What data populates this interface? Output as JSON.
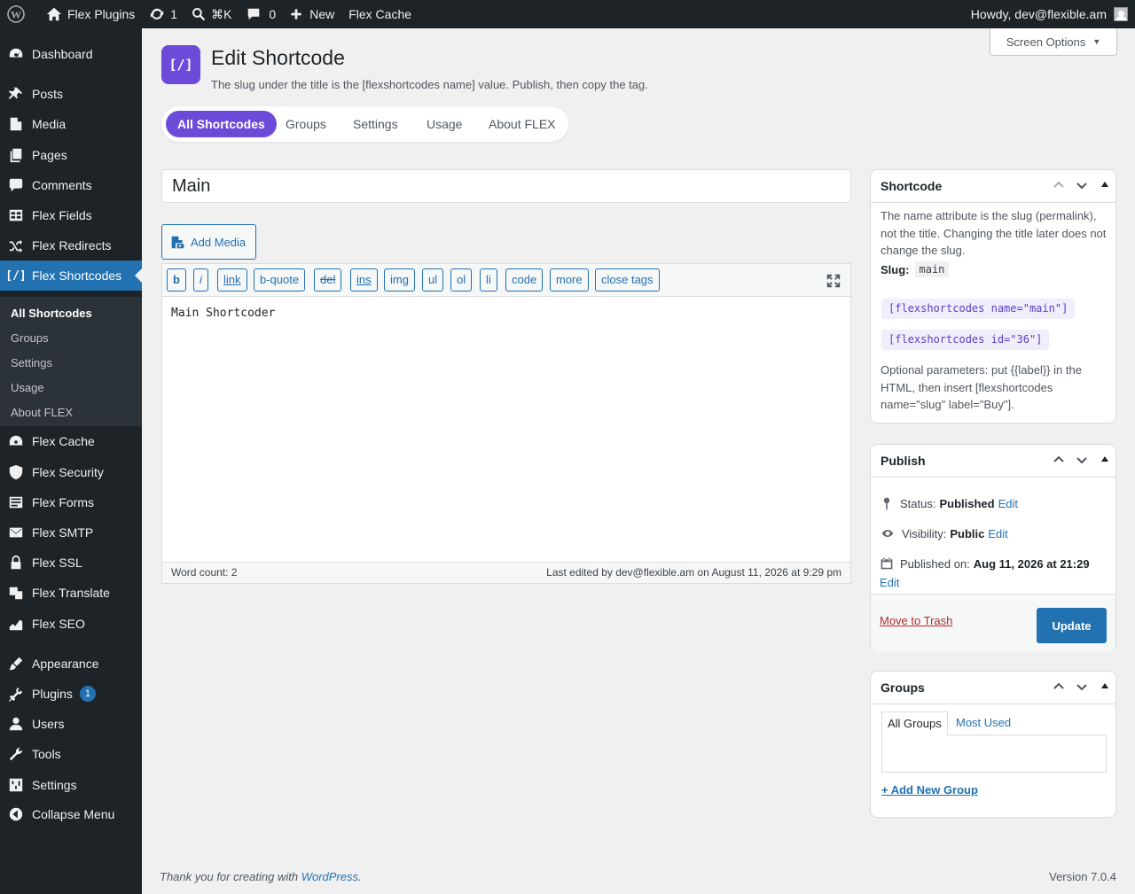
{
  "adminbar": {
    "site_name": "Flex Plugins",
    "updates_count": "1",
    "command_shortcut": "⌘K",
    "comments_count": "0",
    "new_label": "New",
    "flex_cache_label": "Flex Cache",
    "howdy": "Howdy, dev@flexible.am"
  },
  "sidebar": {
    "items": {
      "dashboard": "Dashboard",
      "posts": "Posts",
      "media": "Media",
      "pages": "Pages",
      "comments": "Comments",
      "flex_fields": "Flex Fields",
      "flex_redirects": "Flex Redirects",
      "flex_shortcodes": "Flex Shortcodes",
      "flex_cache": "Flex Cache",
      "flex_security": "Flex Security",
      "flex_forms": "Flex Forms",
      "flex_smtp": "Flex SMTP",
      "flex_ssl": "Flex SSL",
      "flex_translate": "Flex Translate",
      "flex_seo": "Flex SEO",
      "appearance": "Appearance",
      "plugins": "Plugins",
      "plugins_badge": "1",
      "users": "Users",
      "tools": "Tools",
      "settings": "Settings",
      "collapse": "Collapse Menu"
    },
    "submenu": {
      "all_shortcodes": "All Shortcodes",
      "groups": "Groups",
      "settings": "Settings",
      "usage": "Usage",
      "about": "About FLEX"
    }
  },
  "header": {
    "logo_text": "[/]",
    "title": "Edit Shortcode",
    "description": "The slug under the title is the [flexshortcodes name] value. Publish, then copy the tag.",
    "screen_options": "Screen Options"
  },
  "tabs": [
    "All Shortcodes",
    "Groups",
    "Settings",
    "Usage",
    "About FLEX"
  ],
  "editor": {
    "title_value": "Main",
    "add_media": "Add Media",
    "quicktags": [
      "b",
      "i",
      "link",
      "b-quote",
      "del",
      "ins",
      "img",
      "ul",
      "ol",
      "li",
      "code",
      "more",
      "close tags"
    ],
    "content": "Main Shortcoder",
    "word_count": "Word count: 2",
    "last_edited": "Last edited by dev@flexible.am on August 11, 2026 at 9:29 pm"
  },
  "shortcode_box": {
    "title": "Shortcode",
    "intro": "The name attribute is the slug (permalink), not the title. Changing the title later does not change the slug.",
    "slug_label": "Slug:",
    "slug_value": "main",
    "tag_name": "[flexshortcodes name=\"main\"]",
    "tag_id": "[flexshortcodes id=\"36\"]",
    "optional": "Optional parameters: put {{label}} in the HTML, then insert [flexshortcodes name=\"slug\" label=\"Buy\"]."
  },
  "publish_box": {
    "title": "Publish",
    "status_label": "Status:",
    "status_value": "Published",
    "visibility_label": "Visibility:",
    "visibility_value": "Public",
    "published_label": "Published on:",
    "published_value": "Aug 11, 2026 at 21:29",
    "edit": "Edit",
    "trash": "Move to Trash",
    "update": "Update"
  },
  "groups_box": {
    "title": "Groups",
    "tab_all": "All Groups",
    "tab_most_used": "Most Used",
    "add_new": "+ Add New Group"
  },
  "footer": {
    "thanks_prefix": "Thank you for creating with",
    "wordpress_link": "WordPress",
    "thanks_suffix": ".",
    "version": "Version 7.0.4"
  },
  "colors": {
    "accent_purple": "#6c4bd8",
    "wp_blue": "#2271b1",
    "admin_dark": "#1d2327",
    "trash_red": "#b32d2e"
  }
}
